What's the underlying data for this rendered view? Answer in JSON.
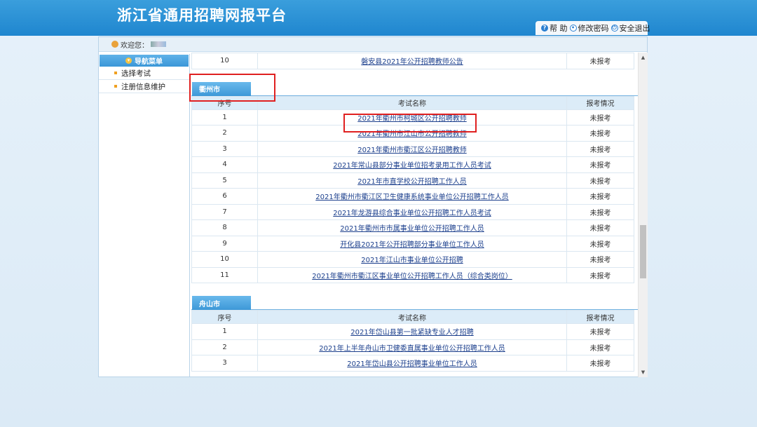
{
  "header": {
    "title": "浙江省通用招聘网报平台",
    "links": [
      {
        "icon": "help-icon",
        "label": "帮 助"
      },
      {
        "icon": "password-icon",
        "label": "修改密码"
      },
      {
        "icon": "power-icon",
        "label": "安全退出"
      }
    ]
  },
  "welcome": {
    "label": "欢迎您："
  },
  "sidebar": {
    "title": "导航菜单",
    "items": [
      {
        "label": "选择考试"
      },
      {
        "label": "注册信息维护"
      }
    ]
  },
  "table_headers": {
    "no": "序号",
    "name": "考试名称",
    "status": "报考情况"
  },
  "top_partial_row": {
    "no": "10",
    "name": "磐安县2021年公开招聘教师公告",
    "status": "未报考"
  },
  "sections": [
    {
      "city": "衢州市",
      "rows": [
        {
          "no": "1",
          "name": "2021年衢州市柯城区公开招聘教师",
          "status": "未报考"
        },
        {
          "no": "2",
          "name": "2021年衢州市江山市公开招聘教师",
          "status": "未报考"
        },
        {
          "no": "3",
          "name": "2021年衢州市衢江区公开招聘教师",
          "status": "未报考"
        },
        {
          "no": "4",
          "name": "2021年常山县部分事业单位招考录用工作人员考试",
          "status": "未报考"
        },
        {
          "no": "5",
          "name": "2021年市直学校公开招聘工作人员",
          "status": "未报考"
        },
        {
          "no": "6",
          "name": "2021年衢州市衢江区卫生健康系统事业单位公开招聘工作人员",
          "status": "未报考"
        },
        {
          "no": "7",
          "name": "2021年龙游县综合事业单位公开招聘工作人员考试",
          "status": "未报考"
        },
        {
          "no": "8",
          "name": "2021年衢州市市属事业单位公开招聘工作人员",
          "status": "未报考"
        },
        {
          "no": "9",
          "name": "开化县2021年公开招聘部分事业单位工作人员",
          "status": "未报考"
        },
        {
          "no": "10",
          "name": "2021年江山市事业单位公开招聘",
          "status": "未报考"
        },
        {
          "no": "11",
          "name": "2021年衢州市衢江区事业单位公开招聘工作人员（综合类岗位）",
          "status": "未报考"
        }
      ]
    },
    {
      "city": "舟山市",
      "rows": [
        {
          "no": "1",
          "name": "2021年岱山县第一批紧缺专业人才招聘",
          "status": "未报考"
        },
        {
          "no": "2",
          "name": "2021年上半年舟山市卫健委直属事业单位公开招聘工作人员",
          "status": "未报考"
        },
        {
          "no": "3",
          "name": "2021年岱山县公开招聘事业单位工作人员",
          "status": "未报考"
        }
      ]
    }
  ]
}
